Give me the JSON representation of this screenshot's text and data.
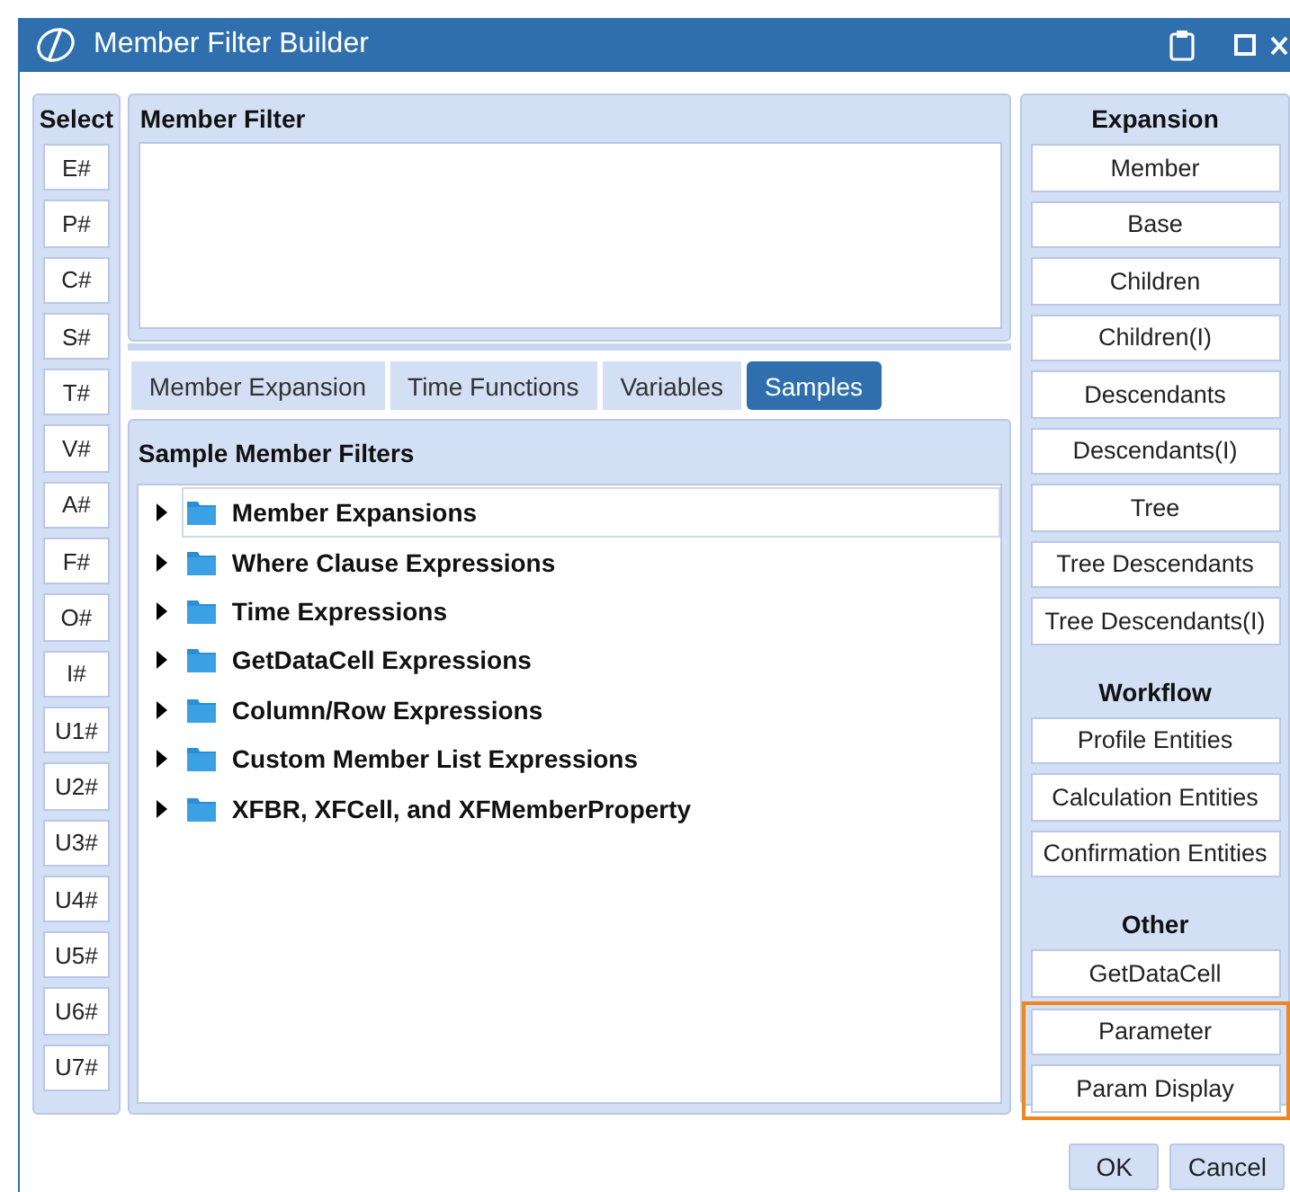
{
  "window": {
    "title": "Member Filter Builder"
  },
  "select_panel": {
    "title": "Select",
    "buttons": [
      "E#",
      "P#",
      "C#",
      "S#",
      "T#",
      "V#",
      "A#",
      "F#",
      "O#",
      "I#",
      "U1#",
      "U2#",
      "U3#",
      "U4#",
      "U5#",
      "U6#",
      "U7#"
    ]
  },
  "member_filter": {
    "title": "Member Filter"
  },
  "tabs": [
    {
      "label": "Member Expansion",
      "selected": false
    },
    {
      "label": "Time Functions",
      "selected": false
    },
    {
      "label": "Variables",
      "selected": false
    },
    {
      "label": "Samples",
      "selected": true
    }
  ],
  "samples_panel": {
    "title": "Sample Member Filters",
    "tree": [
      {
        "label": "Member Expansions",
        "expanded": false,
        "selected": true
      },
      {
        "label": "Where Clause Expressions",
        "expanded": false,
        "selected": false
      },
      {
        "label": "Time Expressions",
        "expanded": false,
        "selected": false
      },
      {
        "label": "GetDataCell Expressions",
        "expanded": false,
        "selected": false
      },
      {
        "label": "Column/Row Expressions",
        "expanded": false,
        "selected": false
      },
      {
        "label": "Custom Member List Expressions",
        "expanded": false,
        "selected": false
      },
      {
        "label": "XFBR, XFCell, and XFMemberProperty",
        "expanded": false,
        "selected": false
      }
    ]
  },
  "right_panel": {
    "sections": [
      {
        "title": "Expansion",
        "buttons": [
          {
            "label": "Member",
            "highlighted": false
          },
          {
            "label": "Base",
            "highlighted": false
          },
          {
            "label": "Children",
            "highlighted": false
          },
          {
            "label": "Children(I)",
            "highlighted": false
          },
          {
            "label": "Descendants",
            "highlighted": false
          },
          {
            "label": "Descendants(I)",
            "highlighted": false
          },
          {
            "label": "Tree",
            "highlighted": false
          },
          {
            "label": "Tree Descendants",
            "highlighted": false
          },
          {
            "label": "Tree Descendants(I)",
            "highlighted": false
          }
        ]
      },
      {
        "title": "Workflow",
        "buttons": [
          {
            "label": "Profile Entities",
            "highlighted": false
          },
          {
            "label": "Calculation Entities",
            "highlighted": false
          },
          {
            "label": "Confirmation Entities",
            "highlighted": false
          }
        ]
      },
      {
        "title": "Other",
        "buttons": [
          {
            "label": "GetDataCell",
            "highlighted": false
          },
          {
            "label": "Parameter",
            "highlighted": true
          },
          {
            "label": "Param Display",
            "highlighted": true
          }
        ]
      }
    ]
  },
  "buttons": [
    "OK",
    "Cancel"
  ]
}
